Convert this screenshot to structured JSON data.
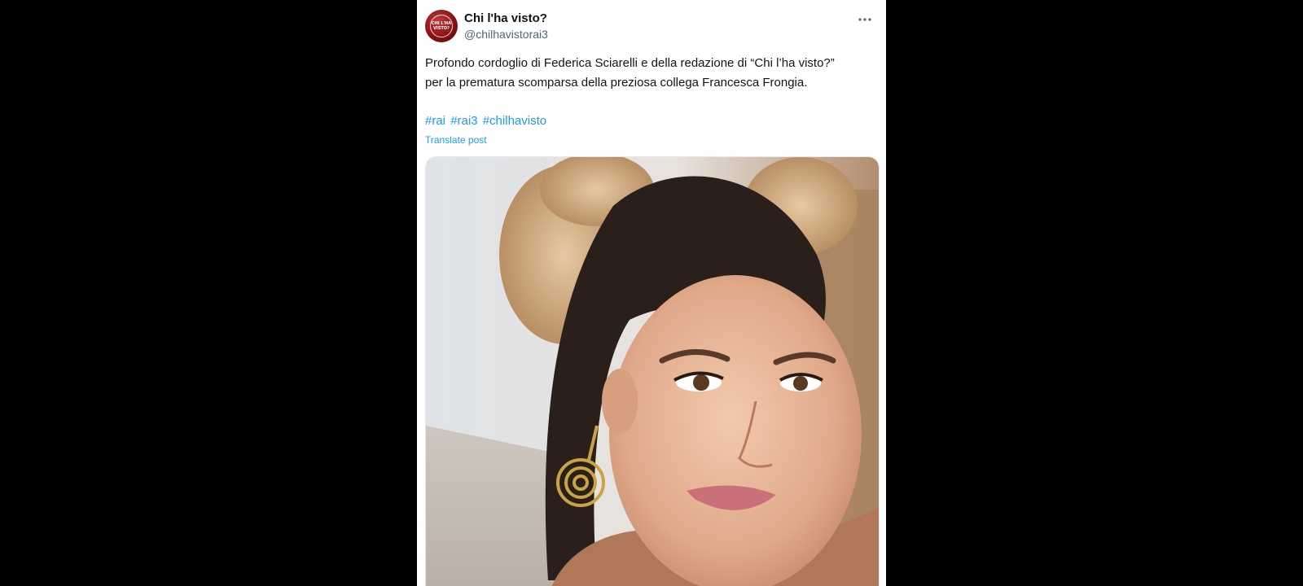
{
  "tweet": {
    "author": {
      "display_name": "Chi l'ha visto?",
      "handle": "@chilhavistorai3",
      "avatar_icon": "chi-lha-visto-logo",
      "avatar_text": "CHI L'HA VISTO?"
    },
    "more_icon": "more-horizontal-icon",
    "text_line_1": "Profondo cordoglio di Federica Sciarelli e della redazione di “Chi l’ha visto?”",
    "text_line_2": "per la prematura scomparsa della preziosa collega Francesca Frongia.",
    "hashtags": [
      "#rai",
      "#rai3",
      "#chilhavisto"
    ],
    "translate_label": "Translate post",
    "media_alt": "photo"
  },
  "colors": {
    "page_background": "#000000",
    "card_background": "#ffffff",
    "text_primary": "#0f1419",
    "text_secondary": "#536471",
    "link": "#1d9bf0",
    "avatar_red": "#8a1212"
  }
}
